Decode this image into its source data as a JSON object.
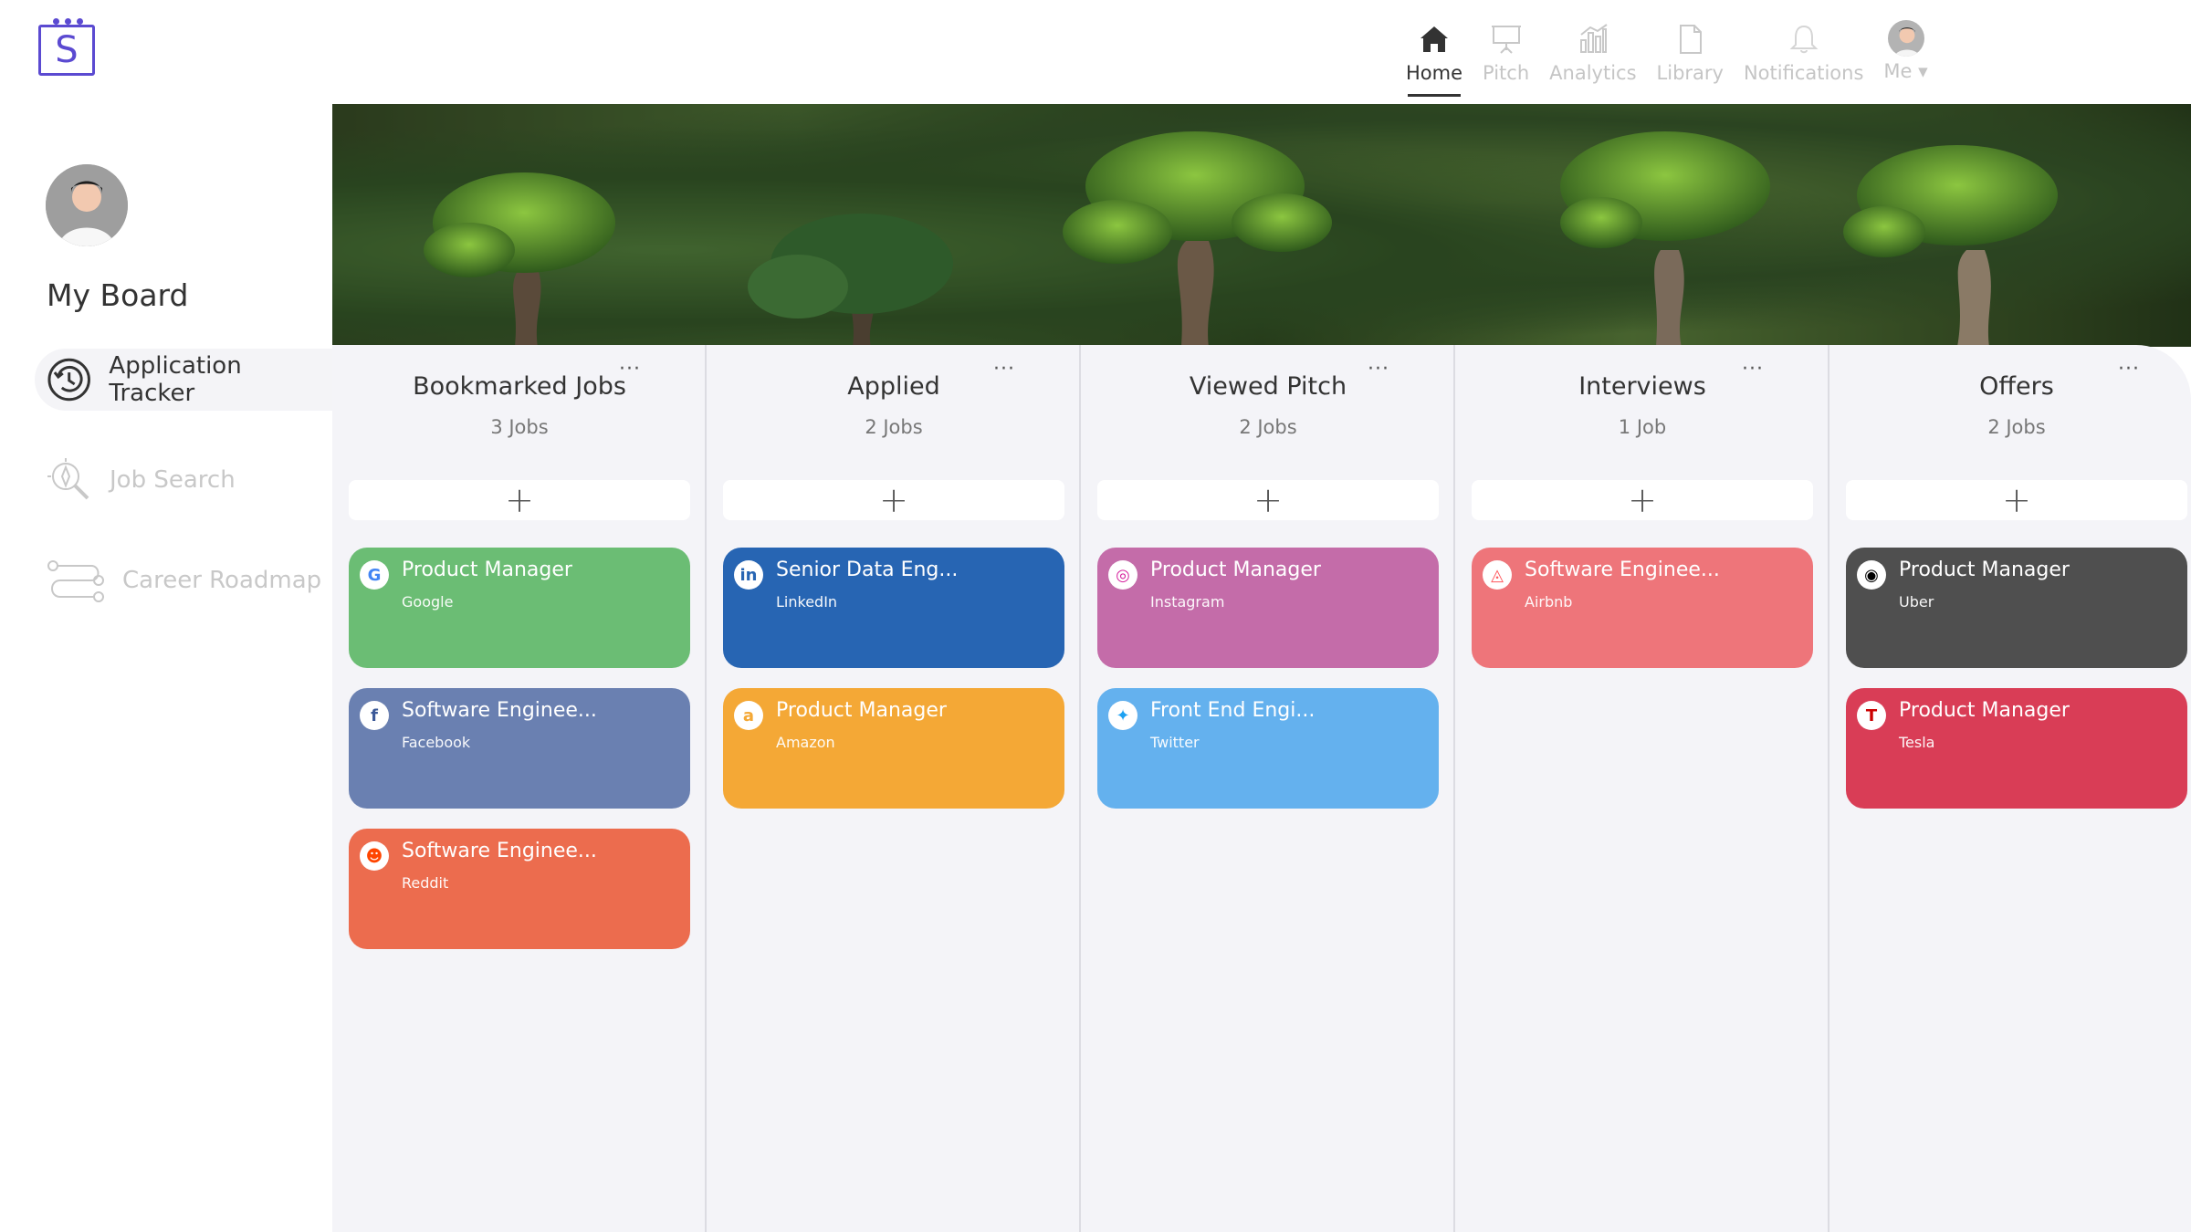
{
  "app": {
    "logo_letter": "S"
  },
  "topnav": [
    {
      "label": "Home",
      "icon": "home-icon",
      "active": true
    },
    {
      "label": "Pitch",
      "icon": "presentation-icon"
    },
    {
      "label": "Analytics",
      "icon": "analytics-icon"
    },
    {
      "label": "Library",
      "icon": "document-icon"
    },
    {
      "label": "Notifications",
      "icon": "bell-icon"
    },
    {
      "label": "Me ▾",
      "icon": "avatar"
    }
  ],
  "sidebar": {
    "title": "My Board",
    "items": [
      {
        "label": "Application Tracker",
        "icon": "tracker-icon",
        "active": true
      },
      {
        "label": "Job Search",
        "icon": "search-compass-icon"
      },
      {
        "label": "Career Roadmap",
        "icon": "roadmap-icon"
      }
    ]
  },
  "columns": [
    {
      "title": "Bookmarked Jobs",
      "count": "3 Jobs",
      "menu": "···",
      "add": "+",
      "cards": [
        {
          "title": "Product Manager",
          "company": "Google",
          "color": "#6bbd74",
          "icon": "google-icon",
          "glyph": "G",
          "glyph_color": "#4285f4"
        },
        {
          "title": "Software Enginee...",
          "company": "Facebook",
          "color": "#6a80b1",
          "icon": "facebook-icon",
          "glyph": "f",
          "glyph_color": "#3b5998"
        },
        {
          "title": "Software Enginee...",
          "company": "Reddit",
          "color": "#ec6c4e",
          "icon": "reddit-icon",
          "glyph": "☻",
          "glyph_color": "#ff4500"
        }
      ]
    },
    {
      "title": "Applied",
      "count": "2 Jobs",
      "menu": "···",
      "add": "+",
      "cards": [
        {
          "title": "Senior Data Eng...",
          "company": "LinkedIn",
          "color": "#2765b3",
          "icon": "linkedin-icon",
          "glyph": "in",
          "glyph_color": "#2765b3"
        },
        {
          "title": "Product Manager",
          "company": "Amazon",
          "color": "#f4a836",
          "icon": "amazon-icon",
          "glyph": "a",
          "glyph_color": "#f4a836"
        }
      ]
    },
    {
      "title": "Viewed Pitch",
      "count": "2 Jobs",
      "menu": "···",
      "add": "+",
      "cards": [
        {
          "title": "Product Manager",
          "company": "Instagram",
          "color": "#c46ca9",
          "icon": "instagram-icon",
          "glyph": "◎",
          "glyph_color": "#d6249f"
        },
        {
          "title": "Front End Engi...",
          "company": "Twitter",
          "color": "#64b1ee",
          "icon": "twitter-icon",
          "glyph": "✦",
          "glyph_color": "#1da1f2"
        }
      ]
    },
    {
      "title": "Interviews",
      "count": "1 Job",
      "menu": "···",
      "add": "+",
      "cards": [
        {
          "title": "Software Enginee...",
          "company": "Airbnb",
          "color": "#ee757a",
          "icon": "airbnb-icon",
          "glyph": "◬",
          "glyph_color": "#ff5a5f"
        }
      ]
    },
    {
      "title": "Offers",
      "count": "2 Jobs",
      "menu": "···",
      "add": "+",
      "cards": [
        {
          "title": "Product Manager",
          "company": "Uber",
          "color": "#4f4f4f",
          "icon": "uber-icon",
          "glyph": "◉",
          "glyph_color": "#000000"
        },
        {
          "title": "Product Manager",
          "company": "Tesla",
          "color": "#d93d56",
          "icon": "tesla-icon",
          "glyph": "T",
          "glyph_color": "#cc0000"
        }
      ]
    }
  ]
}
